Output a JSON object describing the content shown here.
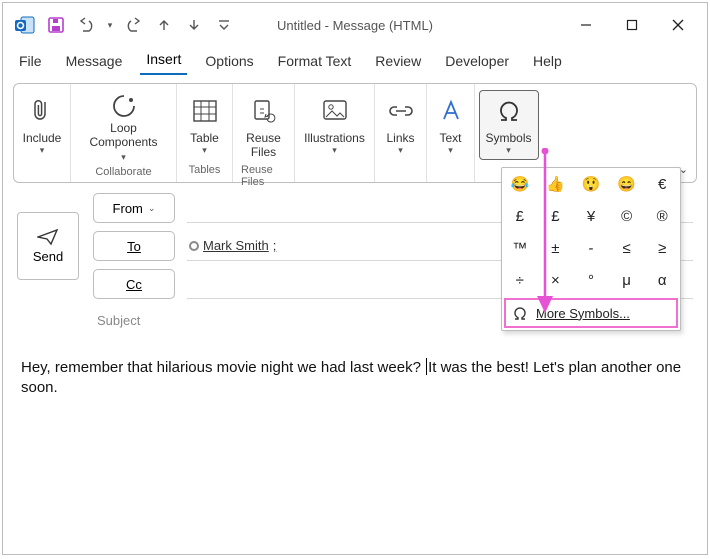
{
  "title": "Untitled  -  Message (HTML)",
  "tabs": {
    "file": "File",
    "message": "Message",
    "insert": "Insert",
    "options": "Options",
    "format": "Format Text",
    "review": "Review",
    "developer": "Developer",
    "help": "Help"
  },
  "ribbon": {
    "include": "Include",
    "loop": "Loop\nComponents",
    "collaborate_grp": "Collaborate",
    "table": "Table",
    "tables_grp": "Tables",
    "reuse": "Reuse\nFiles",
    "reuse_grp": "Reuse Files",
    "illustrations": "Illustrations",
    "links": "Links",
    "text": "Text",
    "symbols": "Symbols"
  },
  "symbols_panel": {
    "r0": [
      "😂",
      "👍",
      "😲",
      "😄",
      "€"
    ],
    "r1": [
      "£",
      "£",
      "¥",
      "©",
      "®"
    ],
    "r2": [
      "™",
      "±",
      "-",
      "≤",
      "≥"
    ],
    "r3": [
      "÷",
      "×",
      "°",
      "μ",
      "α"
    ],
    "more": "More Symbols..."
  },
  "compose": {
    "send": "Send",
    "from": "From",
    "to": "To",
    "cc": "Cc",
    "to_recipient": "Mark Smith",
    "subject_label": "Subject"
  },
  "body": {
    "pre": "Hey, remember that hilarious movie night we had last week? ",
    "post": "It was the best! Let's plan another one soon."
  }
}
